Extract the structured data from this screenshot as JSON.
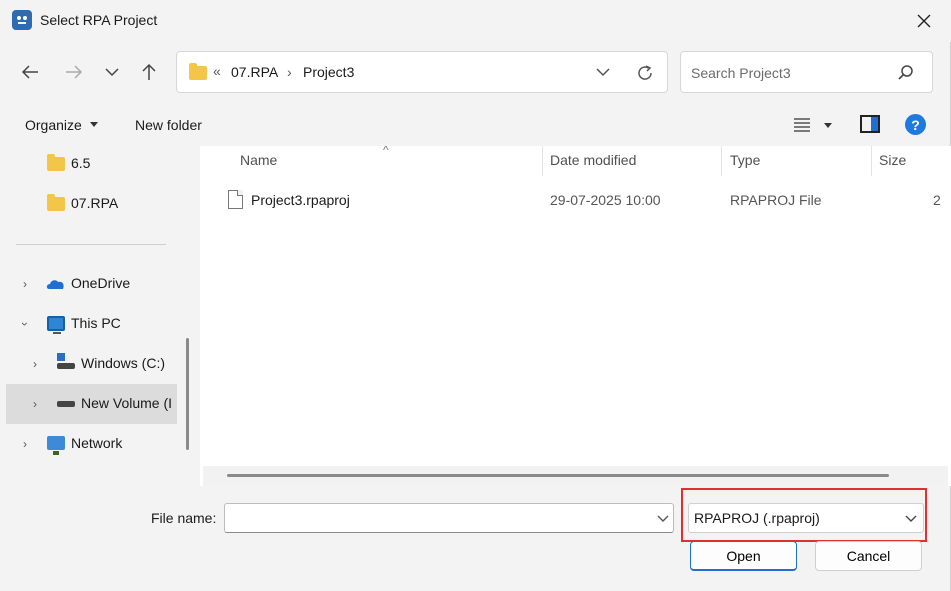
{
  "window": {
    "title": "Select RPA Project"
  },
  "address": {
    "overflow": "«",
    "crumbs": [
      "07.RPA",
      "Project3"
    ],
    "separator": "›"
  },
  "search": {
    "placeholder": "Search Project3"
  },
  "toolbar": {
    "organize_label": "Organize",
    "new_folder_label": "New folder"
  },
  "nav": {
    "items": [
      {
        "label": "6.5",
        "icon": "folder-icon",
        "expand": ""
      },
      {
        "label": "07.RPA",
        "icon": "folder-icon",
        "expand": ""
      },
      {
        "label": "OneDrive",
        "icon": "onedrive-icon",
        "expand": "collapsed"
      },
      {
        "label": "This PC",
        "icon": "pc-icon",
        "expand": "expanded"
      },
      {
        "label": "Windows (C:)",
        "icon": "windows-drive-icon",
        "expand": "collapsed"
      },
      {
        "label": "New Volume (I",
        "icon": "drive-icon",
        "expand": "collapsed",
        "selected": true
      },
      {
        "label": "Network",
        "icon": "network-icon",
        "expand": "collapsed"
      }
    ]
  },
  "columns": {
    "name": "Name",
    "date_modified": "Date modified",
    "type": "Type",
    "size": "Size"
  },
  "files": [
    {
      "name": "Project3.rpaproj",
      "date_modified": "29-07-2025 10:00",
      "type": "RPAPROJ File",
      "size": "2"
    }
  ],
  "footer": {
    "file_name_label": "File name:",
    "file_name_value": "",
    "file_type_value": "RPAPROJ (.rpaproj)",
    "open_label": "Open",
    "cancel_label": "Cancel"
  },
  "colors": {
    "accent": "#1f6fd1",
    "highlight_box": "#e03131",
    "folder": "#f3c64a"
  }
}
